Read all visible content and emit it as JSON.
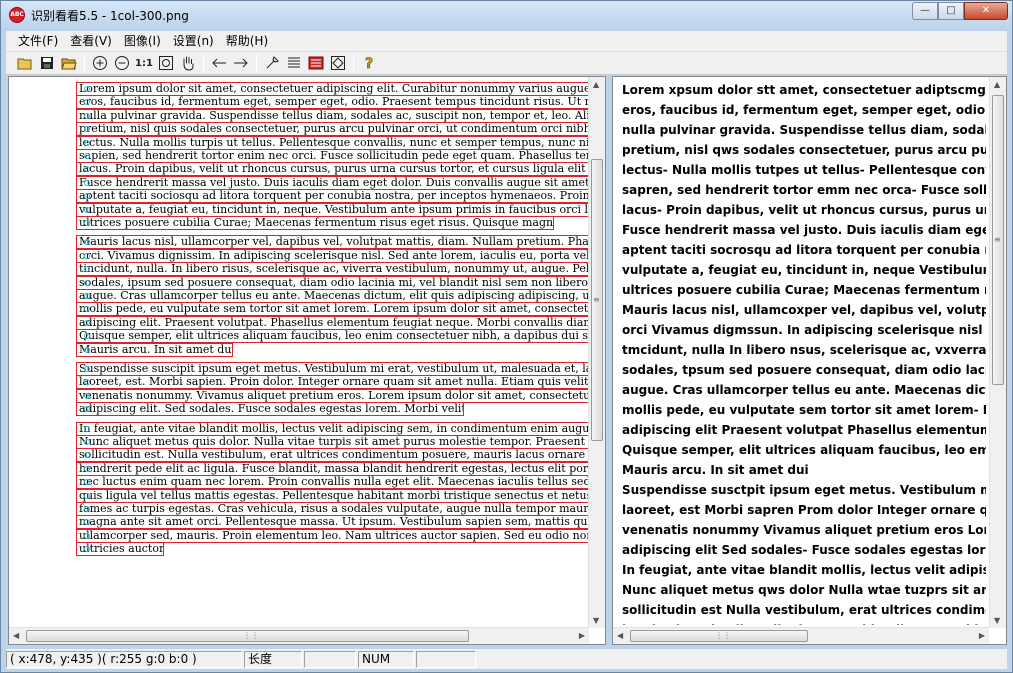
{
  "window": {
    "title": "识别看看5.5 - 1col-300.png",
    "icon": "app-logo-icon",
    "controls": [
      "minimize-icon",
      "maximize-icon",
      "close-icon"
    ]
  },
  "menu": [
    {
      "label": "文件(F)"
    },
    {
      "label": "查看(V)"
    },
    {
      "label": "图像(I)"
    },
    {
      "label": "设置(n)"
    },
    {
      "label": "帮助(H)"
    }
  ],
  "toolbar": {
    "items": [
      "open-icon",
      "save-icon",
      "open-folder-icon",
      "zoom-in-icon",
      "zoom-out-icon",
      "actual-size-icon",
      "fit-icon",
      "hand-pan-icon",
      "arrow-left-icon",
      "arrow-right-icon",
      "wrench-icon",
      "align-icon",
      "book-icon",
      "rotate-icon",
      "help-icon"
    ],
    "actual_size_label": "1:1"
  },
  "left_pane": {
    "lines": [
      "Lorem ipsum dolor sit amet, consectetuer adipiscing elit. Curabitur nonummy varius augue.",
      "eros, faucibus id, fermentum eget, semper eget, odio. Praesent tempus tincidunt risus. Ut no",
      "nulla pulvinar gravida. Suspendisse tellus diam, sodales ac, suscipit non, tempor et, leo. Alic",
      "pretium, nisl quis sodales consectetuer, purus arcu pulvinar orci, ut condimentum orci nibh n",
      "lectus. Nulla mollis turpis ut tellus. Pellentesque convallis, nunc et semper tempus, nunc nibh",
      "sapien, sed hendrerit tortor enim nec orci. Fusce sollicitudin pede eget quam. Phasellus temp",
      "lacus. Proin dapibus, velit ut rhoncus cursus, purus urna cursus tortor, et cursus ligula elit q",
      "Fusce hendrerit massa vel justo. Duis iaculis diam eget dolor. Duis convallis augue sit amet",
      "aptent taciti sociosqu ad litora torquent per conubia nostra, per inceptos hymenaeos. Proin d",
      "vulputate a, feugiat eu, tincidunt in, neque. Vestibulum ante ipsum primis in faucibus orci lu",
      "ultrices posuere cubilia Curae; Maecenas fermentum risus eget risus. Quisque magna",
      "Mauris lacus nisl, ullamcorper vel, dapibus vel, volutpat mattis, diam. Nullam pretium. Phas",
      "orci. Vivamus dignissim. In adipiscing scelerisque nisl. Sed ante lorem, iaculis eu, porta vel",
      "tincidunt, nulla. In libero risus, scelerisque ac, viverra vestibulum, nonummy ut, augue. Pell",
      "sodales, ipsum sed posuere consequat, diam odio lacinia mi, vel blandit nisl sem non libero.",
      "augue. Cras ullamcorper tellus eu ante. Maecenas dictum, elit quis adipiscing adipiscing, ur",
      "mollis pede, eu vulputate sem tortor sit amet lorem. Lorem ipsum dolor sit amet, consectetu",
      "adipiscing elit. Praesent volutpat. Phasellus elementum feugiat neque. Morbi convallis diam",
      "Quisque semper, elit ultrices aliquam faucibus, leo enim consectetuer nibh, a dapibus dui sa",
      "Mauris arcu. In sit amet dui",
      "Suspendisse suscipit ipsum eget metus. Vestibulum mi erat, vestibulum ut, malesuada et, lac",
      "laoreet, est. Morbi sapien. Proin dolor. Integer ornare quam sit amet nulla. Etiam quis velit a",
      "venenatis nonummy. Vivamus aliquet pretium eros. Lorem ipsum dolor sit amet, consectetue",
      "adipiscing elit. Sed sodales. Fusce sodales egestas lorem. Morbi velit",
      "In feugiat, ante vitae blandit mollis, lectus velit adipiscing sem, in condimentum enim augu",
      "Nunc aliquet metus quis dolor. Nulla vitae turpis sit amet purus molestie tempor. Praesent a",
      "sollicitudin est. Nulla vestibulum, erat ultrices condimentum posuere, mauris lacus ornare lo",
      "hendrerit pede elit ac ligula. Fusce blandit, massa blandit hendrerit egestas, lectus elit portti",
      "nec luctus enim quam nec lorem. Proin convallis nulla eget elit. Maecenas iaculis tellus sed",
      "quis ligula vel tellus mattis egestas. Pellentesque habitant morbi tristique senectus et netus e",
      "fames ac turpis egestas. Cras vehicula, risus a sodales vulputate, augue nulla tempor mauris",
      "magna ante sit amet orci. Pellentesque massa. Ut ipsum. Vestibulum sapien sem, mattis quis",
      "ullamcorper sed, mauris. Proin elementum leo. Nam ultrices auctor sapien. Sed eu odio non",
      "ultricies auctor."
    ]
  },
  "right_pane": {
    "lines": [
      "Lorem xpsum dolor stt amet, consectetuer adiptscmg elit",
      "eros, faucibus id, fermentum eget, semper eget, odio. Pr",
      "nulla pulvinar gravida. Suspendisse tellus diam, sodales",
      "pretium, nisl qws sodales consectetuer, purus arcu pulvi",
      "lectus- Nulla mollis tutpes ut tellus- Pellentesque conval",
      "sapren, sed hendrerit tortor emm nec orca- Fusce sollicit",
      "lacus- Proin dapibus, velit ut rhoncus cursus, purus urna",
      "Fusce hendrerit massa vel justo. Duis iaculis diam eget",
      "aptent taciti socrosqu ad litora torquent per conubia nost",
      "vulputate a, feugiat eu, tincidunt in, neque Vestibulum an",
      "ultrices posuere cubilia Curae; Maecenas fermentum nsu",
      "Mauris lacus nisl, ullamcoxper vel, dapibus vel, volutpa",
      "orci Vivamus digmssun. In adipiscing scelerisque nisl S",
      "tmcidunt, nulla In libero nsus, scelerisque ac, vxverra ve",
      "sodales, tpsum sed posuere consequat, diam odio lacini",
      "augue. Cras ullamcorper tellus eu ante. Maecenas dictur",
      "mollis pede, eu vulputate sem tortor sit amet lorem- Lore",
      "adipiscing elit Praesent volutpat Phasellus elementum fe",
      "Quisque semper, elit ultrices aliquam faucibus, leo emm",
      "Mauris arcu. In sit amet dui",
      "Suspendisse susctpit ipsum eget metus. Vestibulum mx",
      "laoreet, est Morbi sapren Prom dolor Integer ornare quar",
      "venenatis nonummy Vivamus aliquet pretium eros Loren",
      "adipiscing elit Sed sodales- Fusce sodales egestas lore",
      "In feugiat, ante vitae blandit mollis, lectus velit adipiscin",
      "Nunc aliquet metus qws dolor Nulla wtae tuzprs sit amet",
      "sollicitudin est Nulla vestibulum, erat ultrices condiment",
      "hendrerit pede elit ac ligula. Fusce blandit, massa bland"
    ]
  },
  "status": {
    "coords": "( x:478, y:435 )( r:255 g:0 b:0 )",
    "length_label": "长度",
    "empty": "",
    "num": "NUM"
  },
  "colors": {
    "box_border": "#e0202a",
    "marker": "#25c3d6",
    "chrome": "#f0f0f0"
  }
}
